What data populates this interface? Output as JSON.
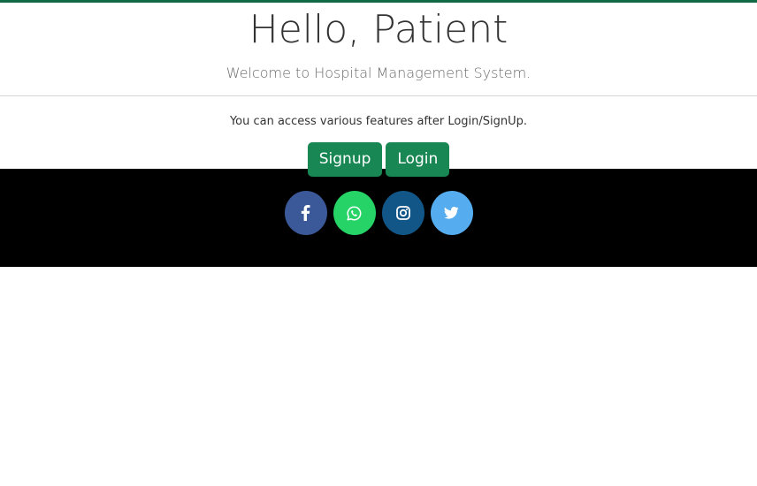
{
  "hero": {
    "title": "Hello, Patient",
    "subtitle": "Welcome to Hospital Management System."
  },
  "cta": {
    "info": "You can access various features after Login/SignUp.",
    "signup_label": "Signup",
    "login_label": "Login",
    "button_color": "#198754"
  },
  "footer": {
    "background": "#000000",
    "social": [
      {
        "name": "facebook-icon",
        "color": "#3b5998"
      },
      {
        "name": "whatsapp-icon",
        "color": "#25d366"
      },
      {
        "name": "instagram-icon",
        "color": "#125688"
      },
      {
        "name": "twitter-icon",
        "color": "#55acee"
      }
    ]
  },
  "theme": {
    "top_border_color": "#0f6a45"
  }
}
